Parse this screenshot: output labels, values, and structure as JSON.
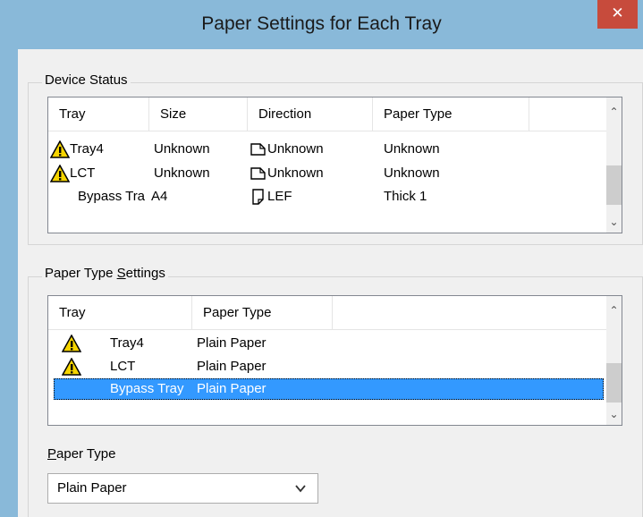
{
  "window": {
    "title": "Paper Settings for Each Tray",
    "close_glyph": "✕"
  },
  "device_status": {
    "label": "Device Status",
    "columns": [
      "Tray",
      "Size",
      "Direction",
      "Paper Type"
    ],
    "rows": [
      {
        "tray": "Tray4",
        "size": "Unknown",
        "direction": "Unknown",
        "paper_type": "Unknown",
        "warning": true,
        "direction_icon": "landscape-paper-icon"
      },
      {
        "tray": "LCT",
        "size": "Unknown",
        "direction": "Unknown",
        "paper_type": "Unknown",
        "warning": true,
        "direction_icon": "landscape-paper-icon"
      },
      {
        "tray": "Bypass Tra",
        "size": "A4",
        "direction": "LEF",
        "paper_type": "Thick 1",
        "warning": false,
        "direction_icon": "portrait-paper-icon"
      }
    ]
  },
  "paper_type_settings": {
    "label_pre": "Paper Type ",
    "label_key": "S",
    "label_post": "ettings",
    "columns": [
      "Tray",
      "Paper Type"
    ],
    "rows": [
      {
        "tray": "Tray4",
        "paper_type": "Plain Paper",
        "warning": true,
        "selected": false
      },
      {
        "tray": "LCT",
        "paper_type": "Plain Paper",
        "warning": true,
        "selected": false
      },
      {
        "tray": "Bypass Tray",
        "paper_type": "Plain Paper",
        "warning": false,
        "selected": true
      }
    ]
  },
  "paper_type": {
    "label_key": "P",
    "label_post": "aper Type",
    "selected": "Plain Paper"
  },
  "colors": {
    "title_bar": "#89b9d9",
    "close_button": "#c74b3c",
    "selection": "#3399ff"
  }
}
